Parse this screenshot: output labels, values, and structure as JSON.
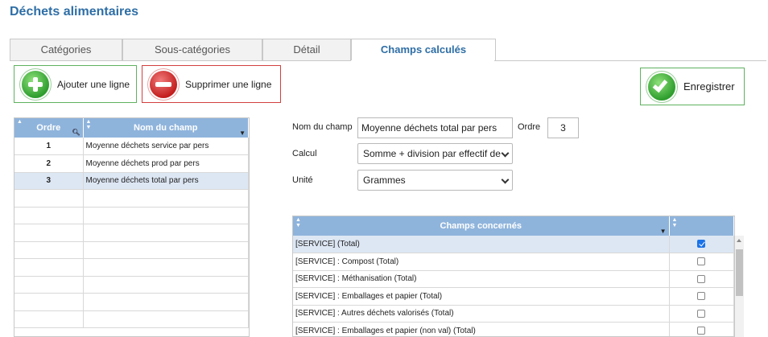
{
  "page": {
    "title": "Déchets alimentaires"
  },
  "tabs": [
    {
      "label": "Catégories",
      "active": false
    },
    {
      "label": "Sous-catégories",
      "active": false
    },
    {
      "label": "Détail",
      "active": false
    },
    {
      "label": "Champs calculés",
      "active": true
    }
  ],
  "toolbar": {
    "add_label": "Ajouter une ligne",
    "delete_label": "Supprimer une ligne",
    "save_label": "Enregistrer"
  },
  "left_grid": {
    "columns": [
      "Ordre",
      "Nom du champ"
    ],
    "rows": [
      {
        "ordre": "1",
        "nom": "Moyenne déchets service par pers"
      },
      {
        "ordre": "2",
        "nom": "Moyenne déchets prod par pers"
      },
      {
        "ordre": "3",
        "nom": "Moyenne déchets total par pers"
      },
      {
        "ordre": "",
        "nom": ""
      },
      {
        "ordre": "",
        "nom": ""
      },
      {
        "ordre": "",
        "nom": ""
      },
      {
        "ordre": "",
        "nom": ""
      },
      {
        "ordre": "",
        "nom": ""
      },
      {
        "ordre": "",
        "nom": ""
      },
      {
        "ordre": "",
        "nom": ""
      },
      {
        "ordre": "",
        "nom": ""
      }
    ],
    "selected_index": 2
  },
  "form": {
    "nom_label": "Nom du champ",
    "nom_value": "Moyenne déchets total par pers",
    "ordre_label": "Ordre",
    "ordre_value": "3",
    "calcul_label": "Calcul",
    "calcul_value": "Somme + division par effectif de",
    "unite_label": "Unité",
    "unite_value": "Grammes"
  },
  "right_grid": {
    "columns": [
      "Champs concernés",
      ""
    ],
    "rows": [
      {
        "label": "[SERVICE] (Total)",
        "checked": true
      },
      {
        "label": "[SERVICE] : Compost (Total)",
        "checked": false
      },
      {
        "label": "[SERVICE] : Méthanisation (Total)",
        "checked": false
      },
      {
        "label": "[SERVICE] : Emballages et papier (Total)",
        "checked": false
      },
      {
        "label": "[SERVICE] : Autres déchets valorisés (Total)",
        "checked": false
      },
      {
        "label": "[SERVICE] : Emballages et papier (non val) (Total)",
        "checked": false
      }
    ],
    "selected_index": 0
  },
  "colors": {
    "title": "#2e6ea6",
    "grid_header": "#8fb4dc",
    "selected_row": "#dde7f4",
    "add_border": "#5fb25f",
    "delete_border": "#d24040",
    "checkbox_on": "#1a73e8"
  },
  "icons": {
    "add": "plus-circle-icon",
    "delete": "minus-circle-icon",
    "save": "check-circle-icon"
  }
}
